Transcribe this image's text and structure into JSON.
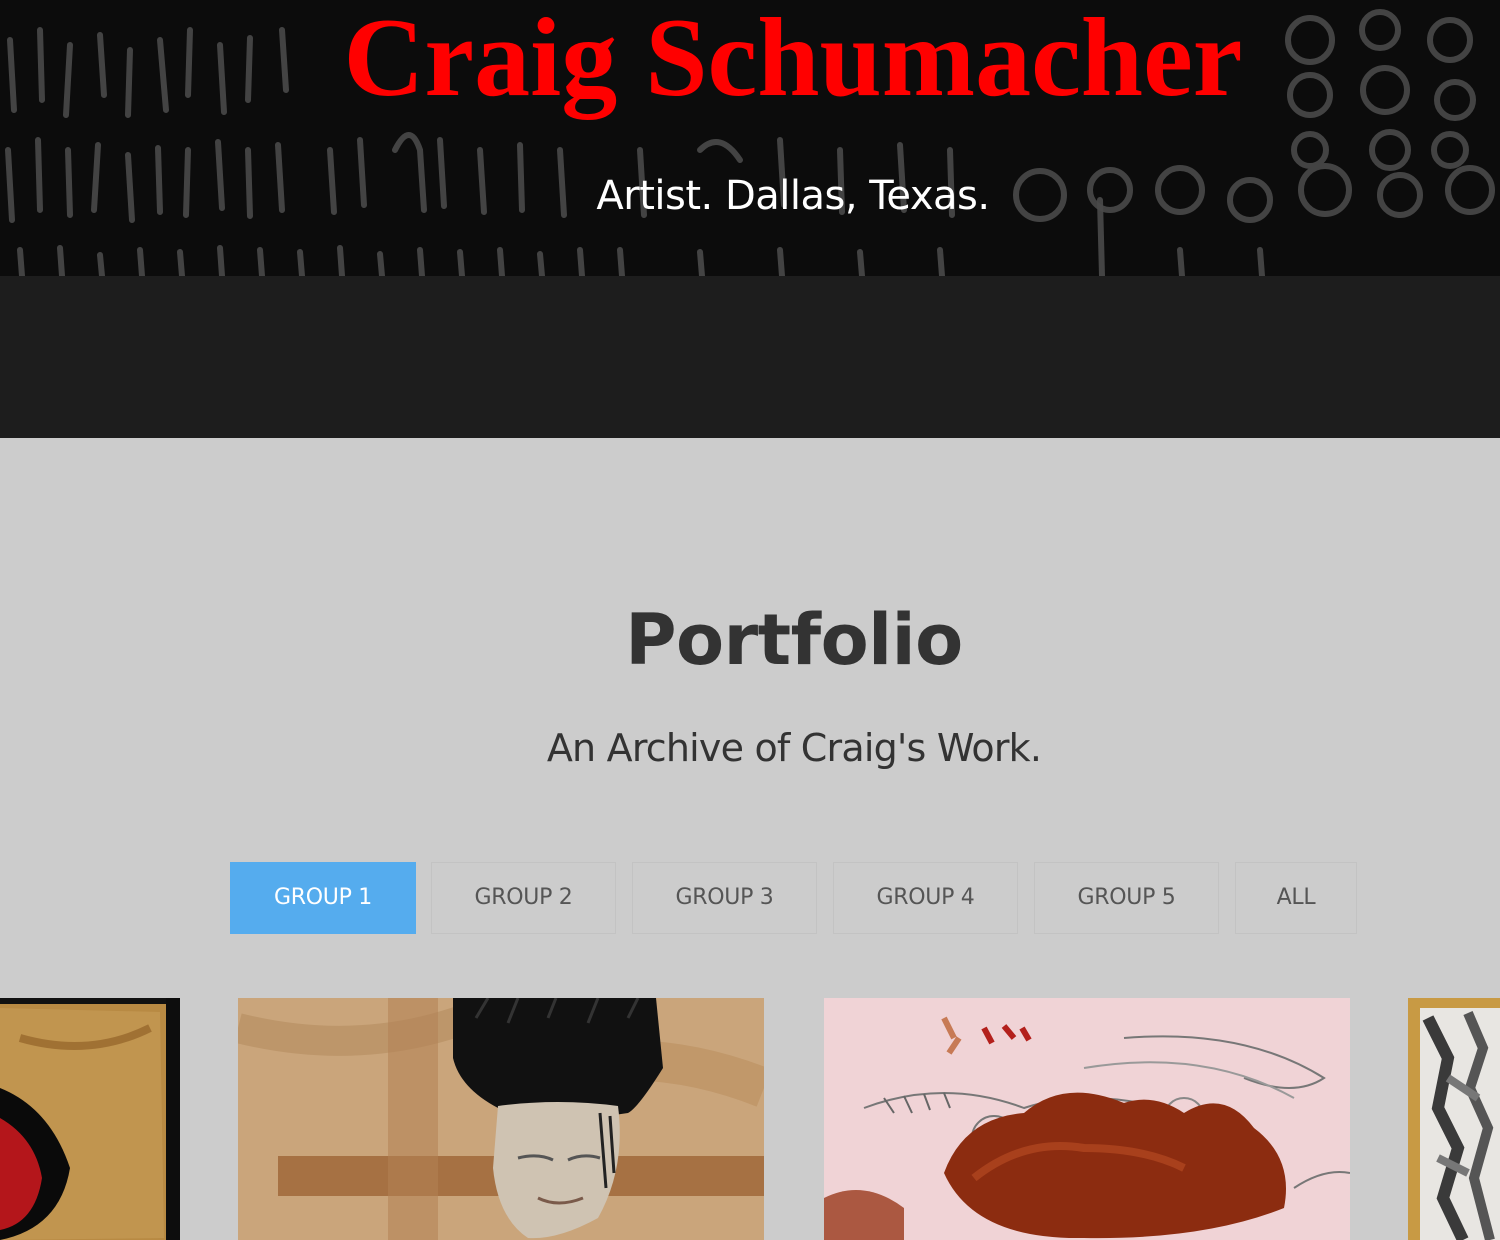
{
  "hero": {
    "title": "Craig Schumacher",
    "subtitle": "Artist. Dallas, Texas."
  },
  "portfolio": {
    "title": "Portfolio",
    "subtitle": "An Archive of Craig's Work.",
    "filters": [
      {
        "label": "GROUP 1",
        "active": true
      },
      {
        "label": "GROUP 2",
        "active": false
      },
      {
        "label": "GROUP 3",
        "active": false
      },
      {
        "label": "GROUP 4",
        "active": false
      },
      {
        "label": "GROUP 5",
        "active": false
      },
      {
        "label": "ALL",
        "active": false
      }
    ]
  },
  "colors": {
    "title_red": "#ff0000",
    "active_filter": "#55acee",
    "band": "#1d1d1d",
    "section_bg": "#cccccc",
    "heading_text": "#333333"
  }
}
